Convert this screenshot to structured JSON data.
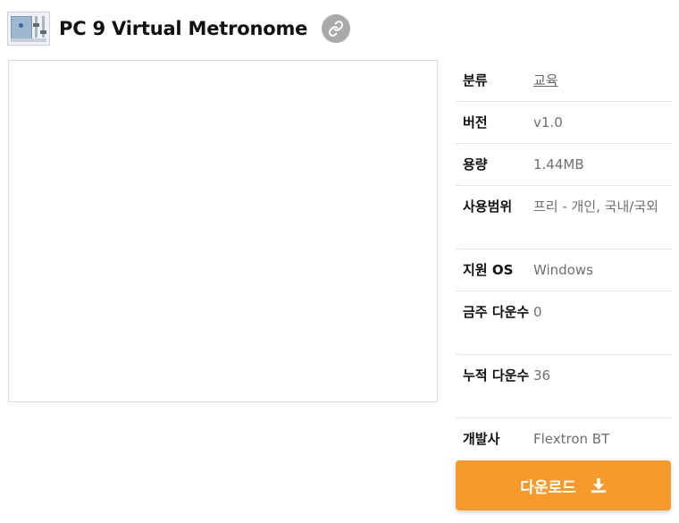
{
  "header": {
    "title": "PC 9 Virtual Metronome",
    "app_icon": "metronome-app-icon",
    "link_icon": "link-icon"
  },
  "info": [
    {
      "label": "분류",
      "value": "교육",
      "is_link": true
    },
    {
      "label": "버전",
      "value": "v1.0"
    },
    {
      "label": "용량",
      "value": "1.44MB"
    },
    {
      "label": "사용범위",
      "value": "프리 - 개인, 국내/국외"
    },
    {
      "label": "지원 OS",
      "value": "Windows"
    },
    {
      "label": "금주 다운수",
      "value": "0"
    },
    {
      "label": "누적 다운수",
      "value": "36"
    },
    {
      "label": "개발사",
      "value": "Flextron BT"
    }
  ],
  "download": {
    "label": "다운로드",
    "icon": "download-icon",
    "color": "#f79a2d"
  }
}
